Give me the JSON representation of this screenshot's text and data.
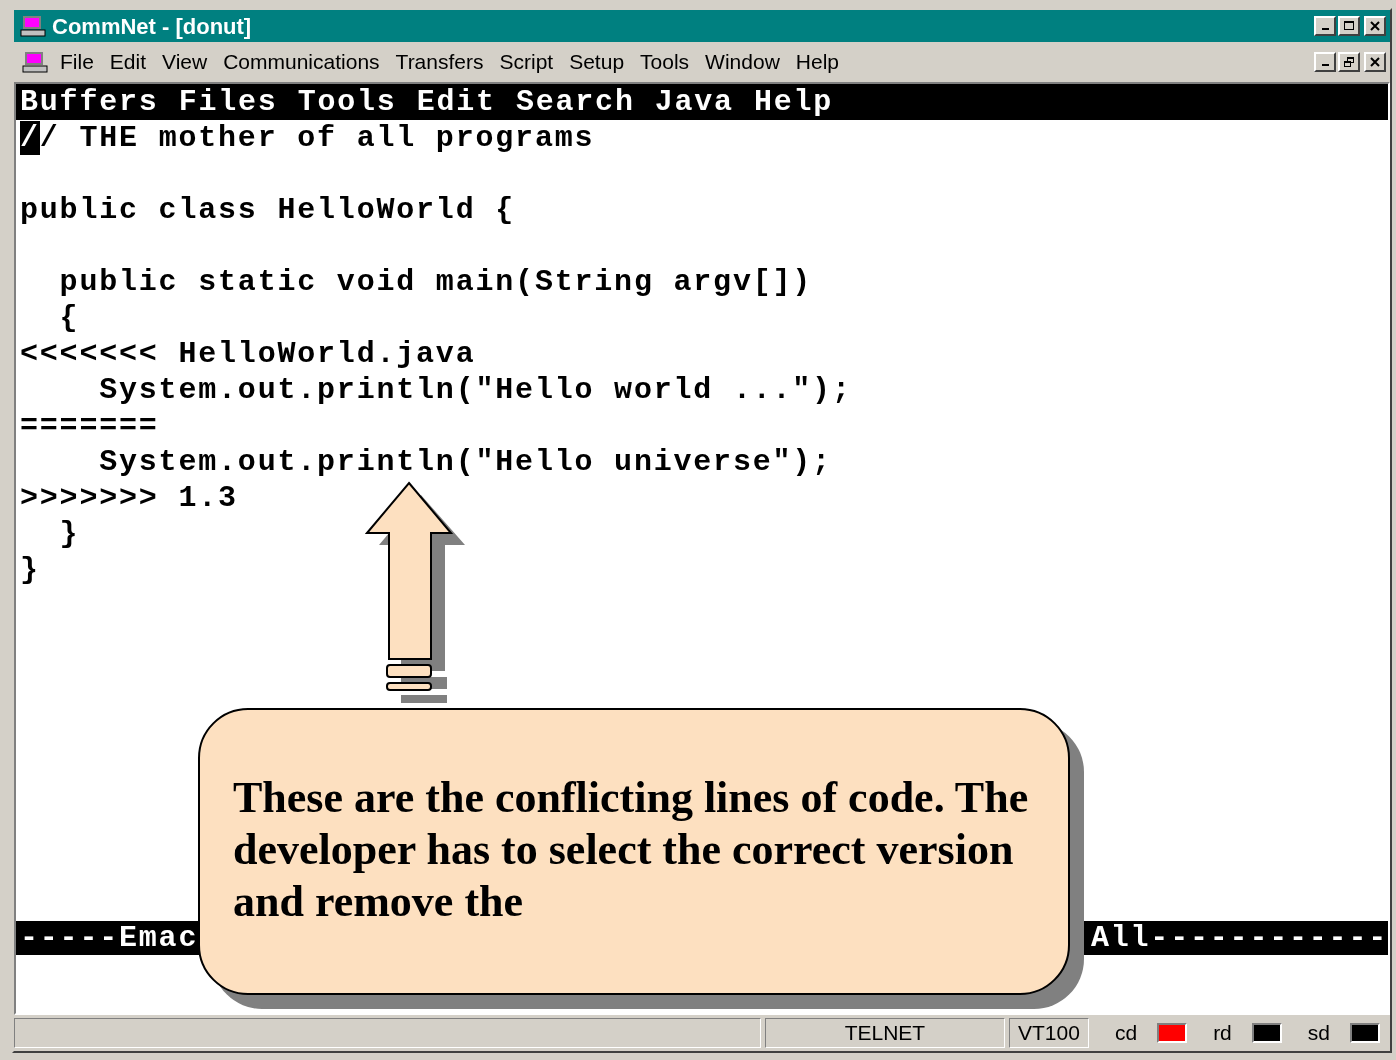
{
  "window": {
    "title": "CommNet - [donut]"
  },
  "menu_bar": [
    "File",
    "Edit",
    "View",
    "Communications",
    "Transfers",
    "Script",
    "Setup",
    "Tools",
    "Window",
    "Help"
  ],
  "emacs_menu": [
    "Buffers",
    "Files",
    "Tools",
    "Edit",
    "Search",
    "Java",
    "Help"
  ],
  "editor": {
    "lines": [
      {
        "kind": "code",
        "text": "// THE mother of all programs",
        "cursor": true
      },
      {
        "kind": "blank"
      },
      {
        "kind": "code",
        "text": "public class HelloWorld {",
        "cursor": false
      },
      {
        "kind": "blank"
      },
      {
        "kind": "code",
        "text": "  public static void main(String argv[])",
        "cursor": false
      },
      {
        "kind": "code",
        "text": "  {",
        "cursor": false
      },
      {
        "kind": "code",
        "text": "<<<<<<< HelloWorld.java",
        "cursor": false
      },
      {
        "kind": "code",
        "text": "    System.out.println(\"Hello world ...\");",
        "cursor": false
      },
      {
        "kind": "code",
        "text": "=======",
        "cursor": false
      },
      {
        "kind": "code",
        "text": "    System.out.println(\"Hello universe\");",
        "cursor": false
      },
      {
        "kind": "code",
        "text": ">>>>>>> 1.3",
        "cursor": false
      },
      {
        "kind": "code",
        "text": "  }",
        "cursor": false
      },
      {
        "kind": "code",
        "text": "}",
        "cursor": false
      }
    ]
  },
  "mode_line": {
    "left": "-----Emac",
    "right": "All------------"
  },
  "callout": {
    "text": "These are the conflicting lines of code. The developer has to select the correct version and remove the"
  },
  "status_bar": {
    "fields": [
      "TELNET",
      "VT100"
    ],
    "indicators": [
      {
        "label": "cd",
        "color": "#ff0000"
      },
      {
        "label": "rd",
        "color": "#000000"
      },
      {
        "label": "sd",
        "color": "#000000"
      }
    ]
  }
}
